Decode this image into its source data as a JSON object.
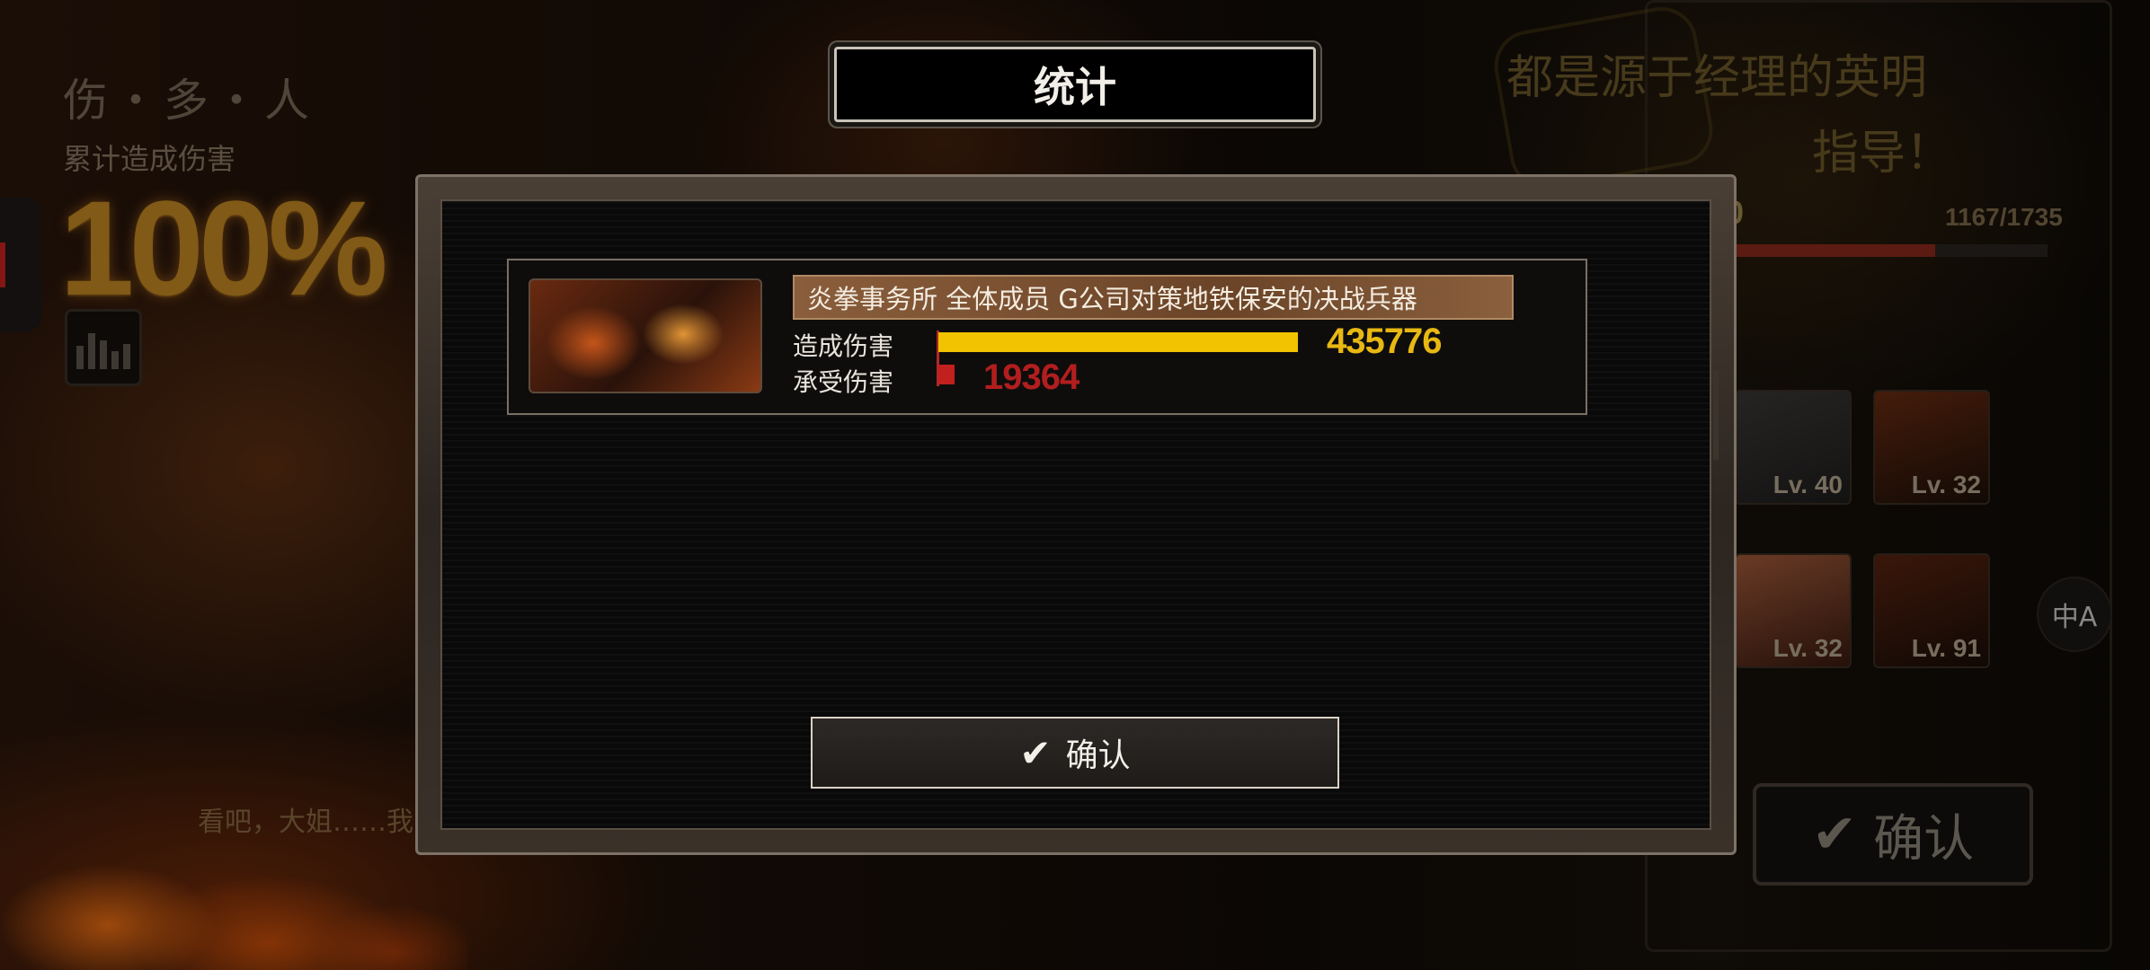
{
  "background": {
    "rank_title": "伤・多・人",
    "total_damage_label": "累计造成伤害",
    "total_damage_percent": "100%",
    "subtitle": "看吧，大姐……我",
    "praise_line1": "都是源于经理的英明",
    "praise_line2": "指导！",
    "stage_code": "-0",
    "progress_text": "1167/1735",
    "progress_value": 0.67,
    "characters": [
      {
        "level": "Lv. 40"
      },
      {
        "level": "Lv. 32"
      },
      {
        "level": "Lv. 32"
      },
      {
        "level": "Lv. 91"
      }
    ],
    "confirm_label": "确认",
    "translate_icon": "中A"
  },
  "dialog": {
    "title": "统计",
    "entries": [
      {
        "name": "炎拳事务所 全体成员 G公司对策地铁保安的决战兵器",
        "damage_dealt_label": "造成伤害",
        "damage_taken_label": "承受伤害",
        "damage_dealt": 435776,
        "damage_taken": 19364,
        "damage_dealt_text": "435776",
        "damage_taken_text": "19364"
      }
    ],
    "confirm_label": "确认"
  },
  "colors": {
    "dealt_bar": "#f2c300",
    "taken_bar": "#c21f1f",
    "accent_gold": "#e8b812"
  },
  "icons": {
    "confirm": "checkmark-icon",
    "stats": "bar-chart-icon",
    "translate": "translate-icon"
  }
}
